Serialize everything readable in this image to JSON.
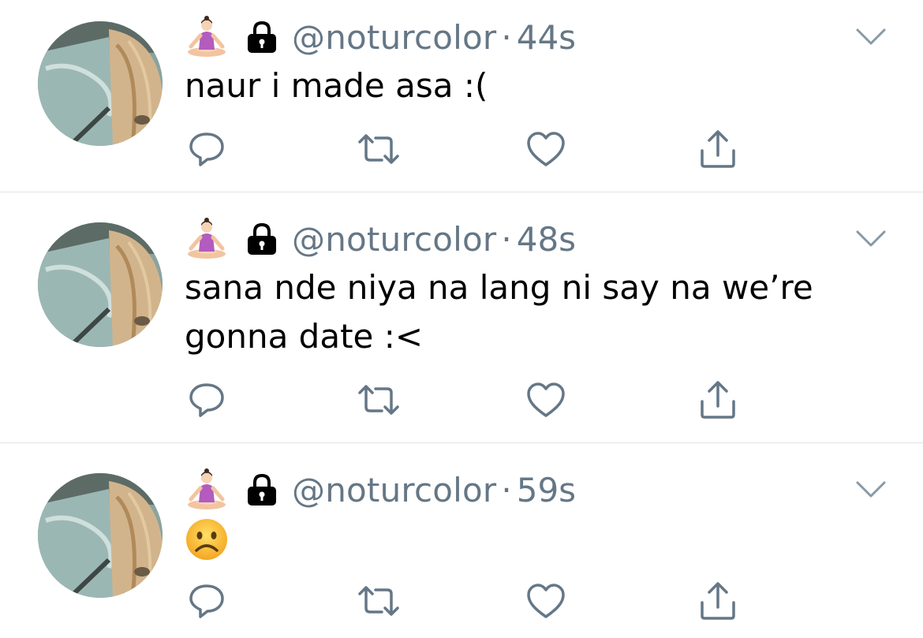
{
  "tweets": [
    {
      "handle": "@noturcolor",
      "separator": "·",
      "time": "44s",
      "text": "naur i made asa :(",
      "content_icon": ""
    },
    {
      "handle": "@noturcolor",
      "separator": "·",
      "time": "48s",
      "text": "sana nde niya na lang ni say na we’re gonna date :<",
      "content_icon": ""
    },
    {
      "handle": "@noturcolor",
      "separator": "·",
      "time": "59s",
      "text": "",
      "content_icon": "frowning-face-emoji"
    }
  ],
  "icons": {
    "name_emoji": "person-in-lotus-position-emoji",
    "protected": "lock-icon",
    "menu": "chevron-down-icon",
    "reply": "reply-icon",
    "retweet": "retweet-icon",
    "like": "heart-icon",
    "share": "share-icon"
  },
  "colors": {
    "secondary_text": "#657786",
    "icon_gray": "#657786",
    "divider": "#dfe3e6"
  }
}
